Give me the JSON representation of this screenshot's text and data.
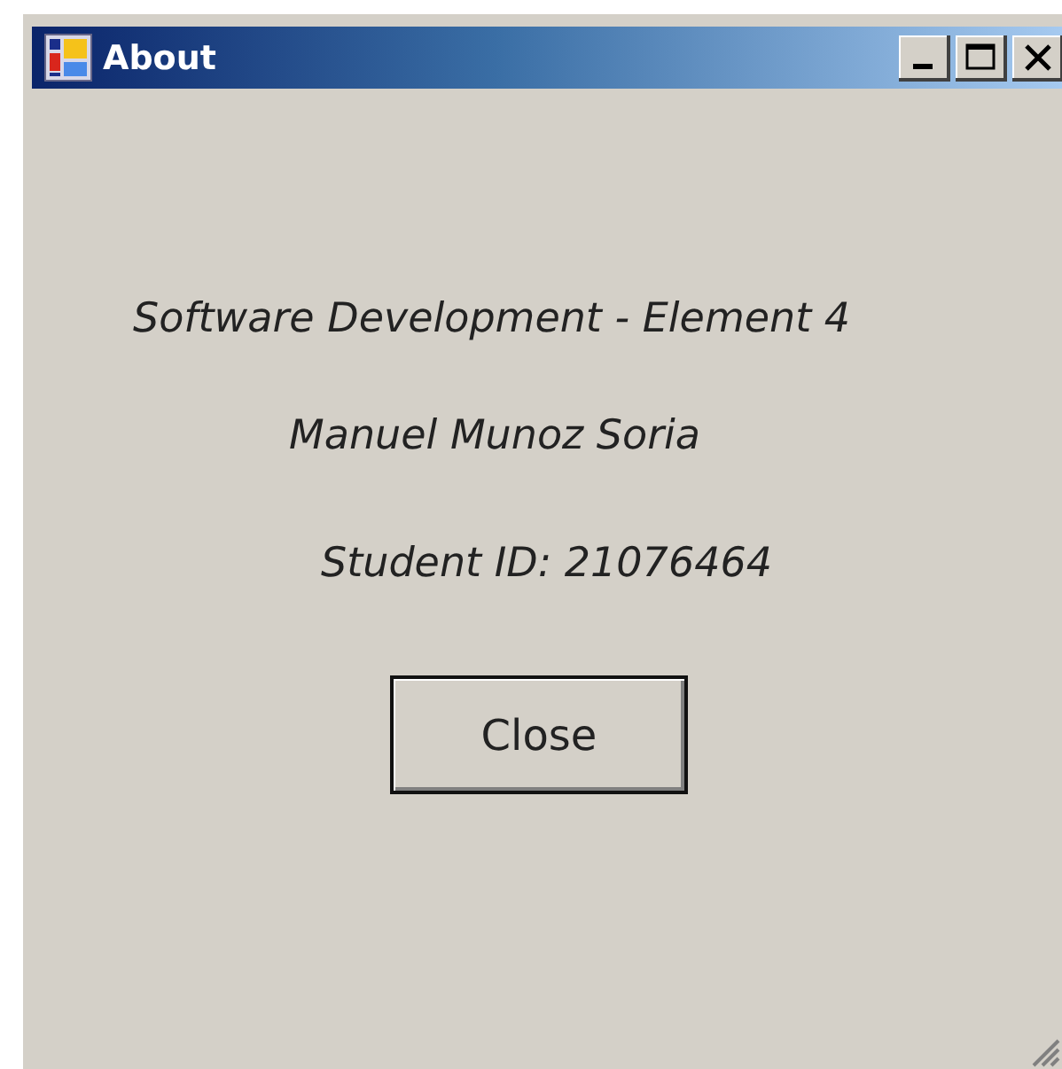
{
  "window": {
    "title": "About"
  },
  "lines": [
    "Software Development - Element 4",
    "Manuel Munoz Soria",
    "Student ID: 21076464"
  ],
  "buttons": [
    "Close"
  ]
}
